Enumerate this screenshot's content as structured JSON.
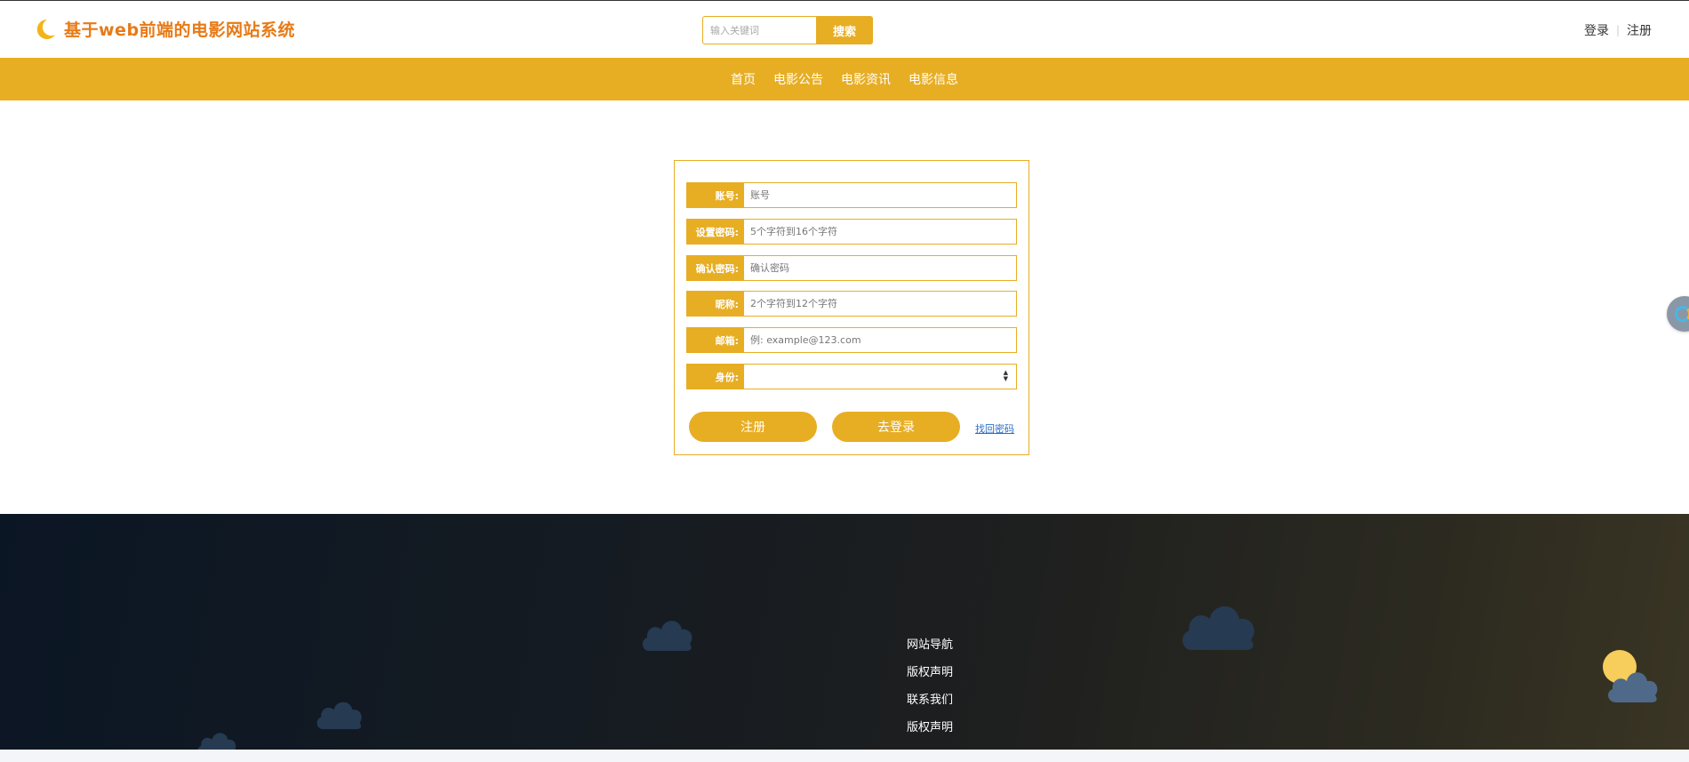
{
  "header": {
    "site_title": "基于web前端的电影网站系统",
    "search_placeholder": "输入关键词",
    "search_button": "搜索",
    "login": "登录",
    "register": "注册",
    "separator": "|"
  },
  "nav": {
    "items": [
      "首页",
      "电影公告",
      "电影资讯",
      "电影信息"
    ]
  },
  "form": {
    "fields": [
      {
        "label": "账号:",
        "placeholder": "账号"
      },
      {
        "label": "设置密码:",
        "placeholder": "5个字符到16个字符"
      },
      {
        "label": "确认密码:",
        "placeholder": "确认密码"
      },
      {
        "label": "昵称:",
        "placeholder": "2个字符到12个字符"
      },
      {
        "label": "邮箱:",
        "placeholder": "例: example@123.com"
      },
      {
        "label": "身份:",
        "placeholder": ""
      }
    ],
    "register_button": "注册",
    "login_button": "去登录",
    "forgot_link": "找回密码"
  },
  "footer": {
    "links": [
      "网站导航",
      "版权声明",
      "联系我们",
      "版权声明"
    ]
  },
  "colors": {
    "accent": "#e7ae24",
    "title": "#e77a16",
    "footer_dark": "#0b1624",
    "cloud": "#263a52"
  },
  "icons": [
    "moon-icon",
    "select-arrows-icon",
    "cloud-icon",
    "sun-icon"
  ]
}
